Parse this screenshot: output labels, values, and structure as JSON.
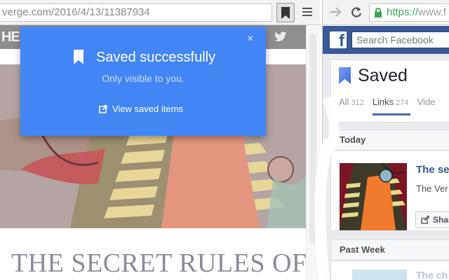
{
  "left_window": {
    "url": "verge.com/2016/4/13/11387934",
    "site_logo": "HE",
    "article_title": "THE SECRET RULES OF THE",
    "icons": {
      "bookmark": "bookmark-filled-icon",
      "menu": "hamburger-menu-icon",
      "twitter": "twitter-icon"
    }
  },
  "popup": {
    "title": "Saved successfully",
    "subtitle": "Only visible to you.",
    "link_label": "View saved items",
    "close_symbol": "×",
    "icons": {
      "close": "close-icon",
      "bookmark": "bookmark-icon",
      "link": "external-link-icon"
    },
    "colors": {
      "background": "#4285f4"
    }
  },
  "right_window": {
    "url_secure": "https://",
    "url_rest": "www.f",
    "icons": {
      "forward": "forward-arrow-icon",
      "reload": "reload-icon",
      "lock": "lock-icon"
    },
    "facebook": {
      "logo_letter": "f",
      "search_placeholder": "Search Facebook",
      "saved_title": "Saved",
      "tabs": [
        {
          "label": "All",
          "count": "312"
        },
        {
          "label": "Links",
          "count": "274"
        },
        {
          "label": "Vide",
          "count": ""
        }
      ],
      "active_tab": "Links",
      "sections": {
        "today": "Today",
        "past_week": "Past Week"
      },
      "item": {
        "title": "The se",
        "source": "The Ver",
        "share_label": "Shar"
      },
      "item2": {
        "title": "The ch"
      },
      "colors": {
        "brand": "#3b5998",
        "link": "#365899"
      }
    }
  }
}
